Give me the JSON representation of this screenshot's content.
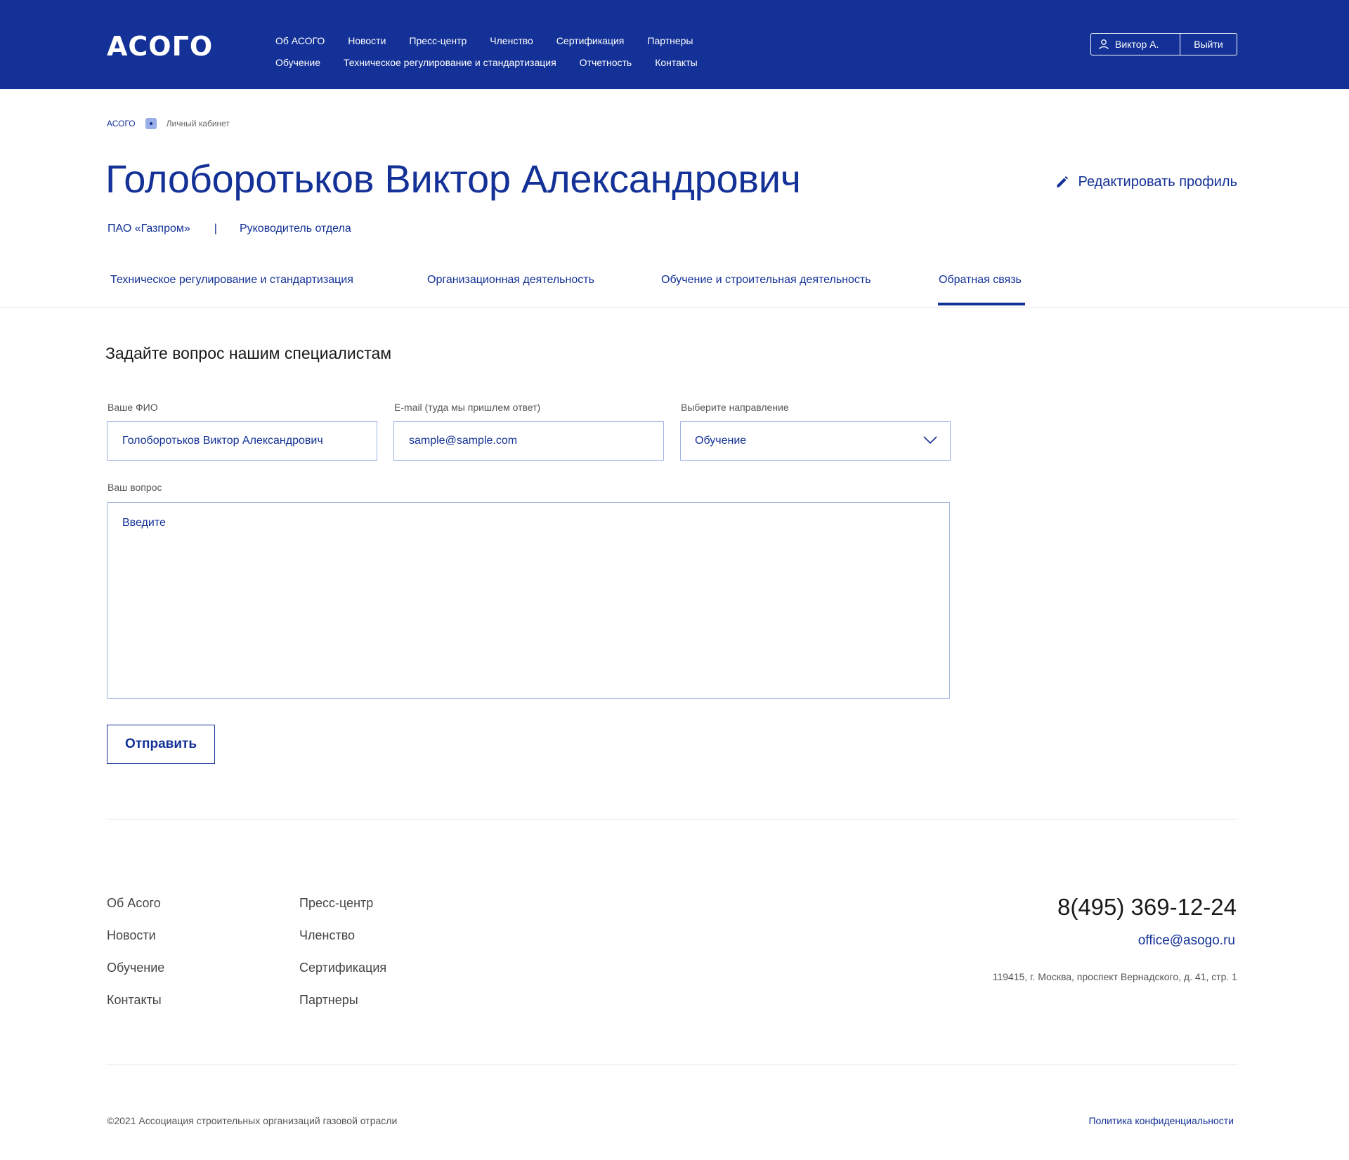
{
  "header": {
    "logo": "АСОГО",
    "nav_row1": [
      "Об АСОГО",
      "Новости",
      "Пресс-центр",
      "Членство",
      "Сертификация",
      "Партнеры"
    ],
    "nav_row2": [
      "Обучение",
      "Техническое регулирование и стандартизация",
      "Отчетность",
      "Контакты"
    ],
    "user_name": "Виктор А.",
    "logout_label": "Выйти",
    "user_icon": "user-icon"
  },
  "breadcrumb": {
    "home": "АСОГО",
    "current": "Личный кабинет"
  },
  "profile": {
    "name": "Голоборотьков Виктор Александрович",
    "company": "ПАО «Газпром»",
    "separator": "|",
    "position": "Руководитель отдела",
    "edit_label": "Редактировать профиль",
    "edit_icon": "pencil-icon"
  },
  "tabs": [
    {
      "label": "Техническое регулирование и стандартизация",
      "active": false
    },
    {
      "label": "Организационная деятельность",
      "active": false
    },
    {
      "label": "Обучение и строительная деятельность",
      "active": false
    },
    {
      "label": "Обратная связь",
      "active": true
    }
  ],
  "form": {
    "heading": "Задайте вопрос нашим специалистам",
    "name_label": "Ваше ФИО",
    "name_value": "Голоборотьков Виктор Александрович",
    "email_label": "E-mail (туда мы пришлем ответ)",
    "email_value": "sample@sample.com",
    "direction_label": "Выберите направление",
    "direction_value": "Обучение",
    "question_label": "Ваш вопрос",
    "question_placeholder": "Введите",
    "submit_label": "Отправить"
  },
  "footer": {
    "col1": [
      "Об Асого",
      "Новости",
      "Обучение",
      "Контакты"
    ],
    "col2": [
      "Пресс-центр",
      "Членство",
      "Сертификация",
      "Партнеры"
    ],
    "phone": "8(495) 369-12-24",
    "email": "office@asogo.ru",
    "address": "119415, г. Москва, проспект Вернадского, д. 41, стр. 1",
    "copyright": "©2021 Ассоциация строительных организаций газовой отрасли",
    "privacy": "Политика конфиденциальности"
  },
  "colors": {
    "brand": "#133196",
    "input_border": "#9fb2e3",
    "divider": "#e3e6ee"
  }
}
